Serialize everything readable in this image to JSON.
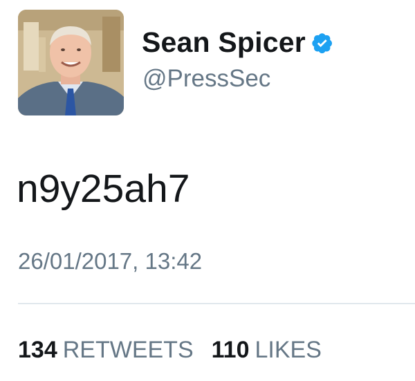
{
  "user": {
    "display_name": "Sean Spicer",
    "handle": "@PressSec",
    "verified": true,
    "avatar_icon": "profile-photo"
  },
  "tweet": {
    "text": "n9y25ah7",
    "timestamp": "26/01/2017, 13:42"
  },
  "stats": {
    "retweets_count": "134",
    "retweets_label": "RETWEETS",
    "likes_count": "110",
    "likes_label": "LIKES"
  },
  "colors": {
    "verified_badge": "#1da1f2",
    "secondary_text": "#657786",
    "primary_text": "#14171a",
    "divider": "#e1e8ed"
  }
}
